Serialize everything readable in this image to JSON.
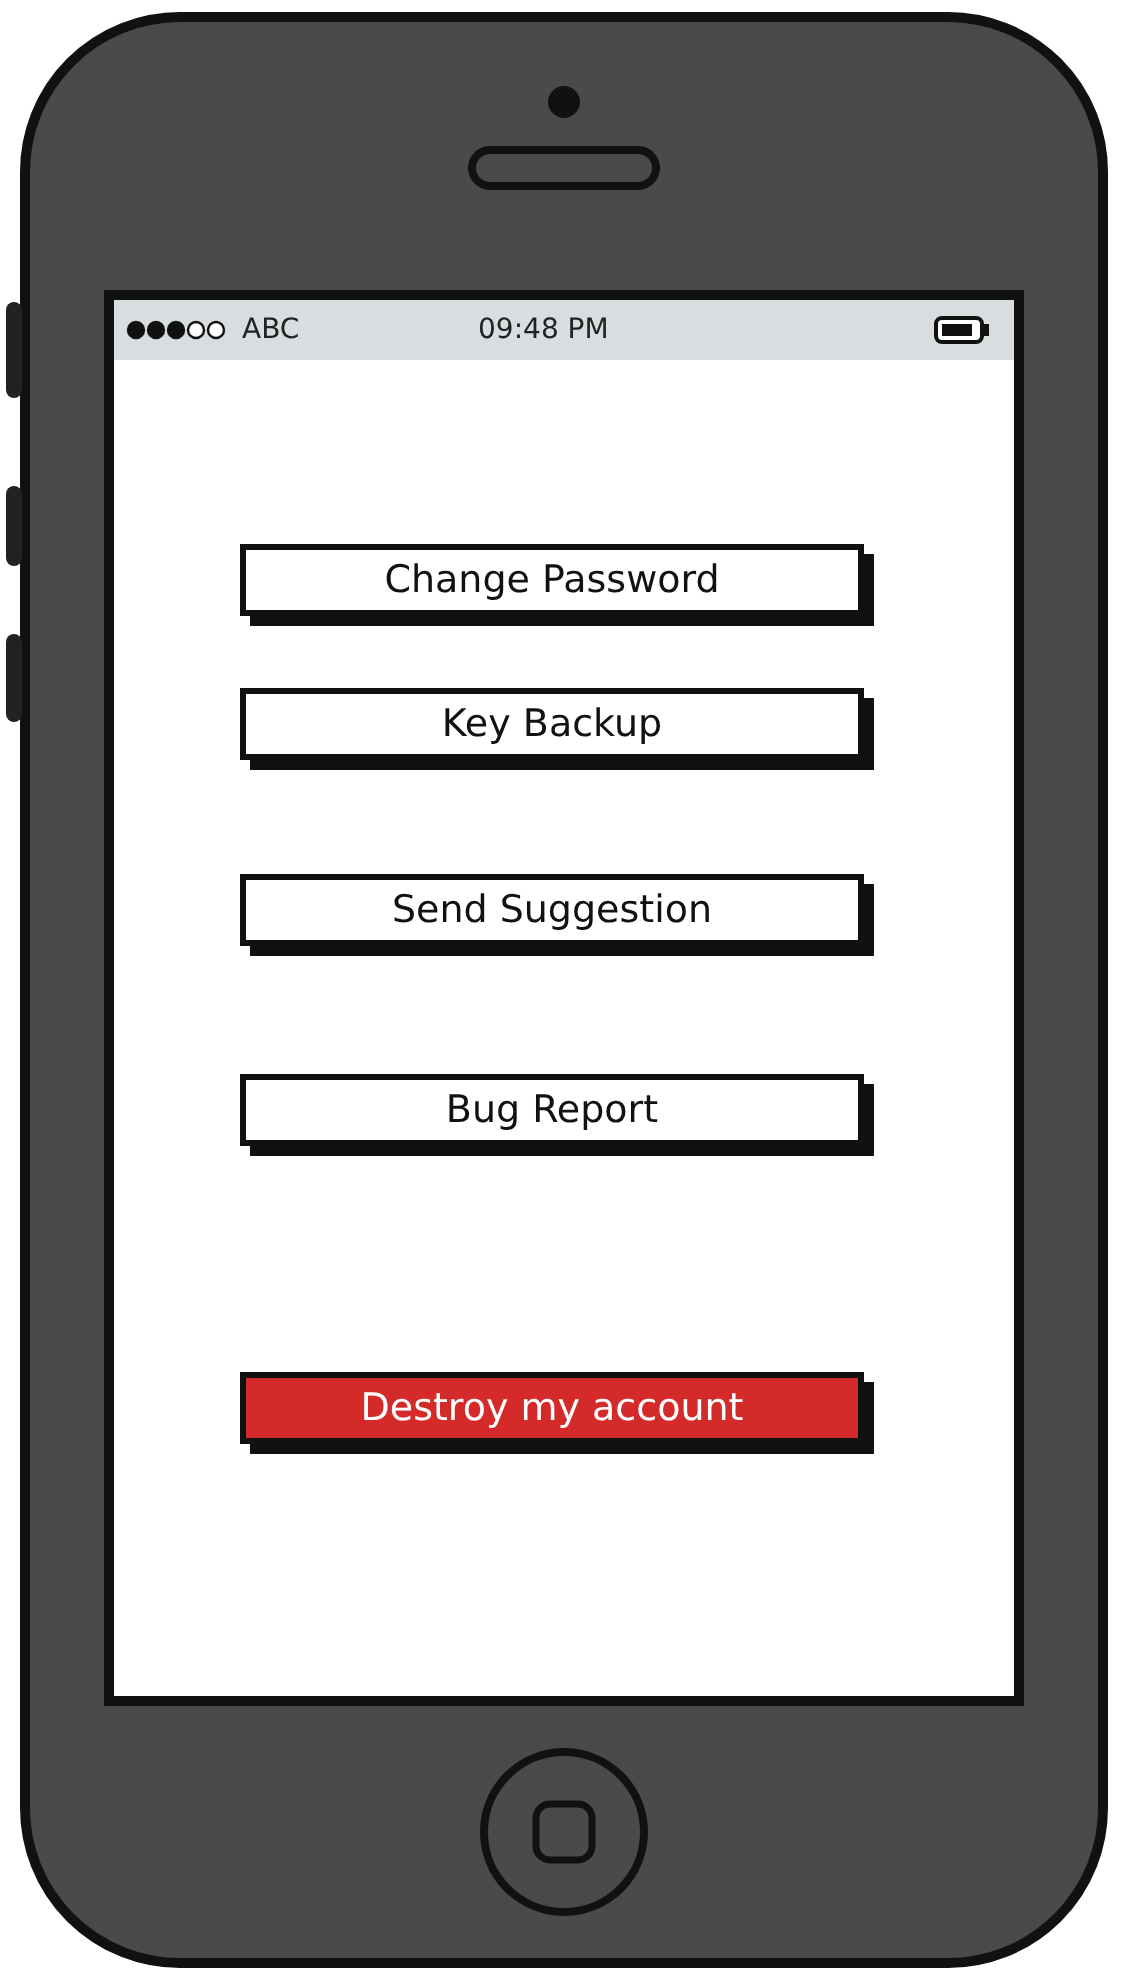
{
  "status_bar": {
    "carrier": "ABC",
    "time": "09:48 PM"
  },
  "buttons": [
    {
      "label": "Change Password",
      "kind": "default"
    },
    {
      "label": "Key Backup",
      "kind": "default"
    },
    {
      "label": "Send Suggestion",
      "kind": "default"
    },
    {
      "label": "Bug Report",
      "kind": "default"
    },
    {
      "label": "Destroy my account",
      "kind": "danger"
    }
  ]
}
